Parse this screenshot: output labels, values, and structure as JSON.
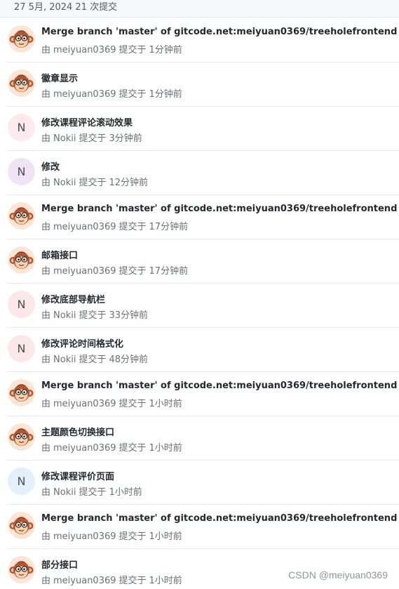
{
  "date_header": "27 5月, 2024 21 次提交",
  "commits": [
    {
      "title": "Merge branch 'master' of gitcode.net:meiyuan0369/treeholefrontend",
      "by": "由",
      "author": "meiyuan0369",
      "submitted": "提交于",
      "time": "1分钟前",
      "avatar": {
        "type": "monkey"
      }
    },
    {
      "title": "徽章显示",
      "by": "由",
      "author": "meiyuan0369",
      "submitted": "提交于",
      "time": "1分钟前",
      "avatar": {
        "type": "monkey"
      }
    },
    {
      "title": "修改课程评论滚动效果",
      "by": "由",
      "author": "Nokii",
      "submitted": "提交于",
      "time": "3分钟前",
      "avatar": {
        "type": "letter",
        "letter": "N",
        "color": "#fde9ee"
      }
    },
    {
      "title": "修改",
      "by": "由",
      "author": "Nokii",
      "submitted": "提交于",
      "time": "12分钟前",
      "avatar": {
        "type": "letter",
        "letter": "N",
        "color": "#f1e3f6"
      }
    },
    {
      "title": "Merge branch 'master' of gitcode.net:meiyuan0369/treeholefrontend",
      "by": "由",
      "author": "meiyuan0369",
      "submitted": "提交于",
      "time": "17分钟前",
      "avatar": {
        "type": "monkey"
      }
    },
    {
      "title": "邮箱接口",
      "by": "由",
      "author": "meiyuan0369",
      "submitted": "提交于",
      "time": "17分钟前",
      "avatar": {
        "type": "monkey"
      }
    },
    {
      "title": "修改底部导航栏",
      "by": "由",
      "author": "Nokii",
      "submitted": "提交于",
      "time": "33分钟前",
      "avatar": {
        "type": "letter",
        "letter": "N",
        "color": "#fce8e6"
      }
    },
    {
      "title": "修改评论时间格式化",
      "by": "由",
      "author": "Nokii",
      "submitted": "提交于",
      "time": "48分钟前",
      "avatar": {
        "type": "letter",
        "letter": "N",
        "color": "#fce8e6"
      }
    },
    {
      "title": "Merge branch 'master' of gitcode.net:meiyuan0369/treeholefrontend",
      "by": "由",
      "author": "meiyuan0369",
      "submitted": "提交于",
      "time": "1小时前",
      "avatar": {
        "type": "monkey"
      }
    },
    {
      "title": "主题颜色切换接口",
      "by": "由",
      "author": "meiyuan0369",
      "submitted": "提交于",
      "time": "1小时前",
      "avatar": {
        "type": "monkey"
      }
    },
    {
      "title": "修改课程评价页面",
      "by": "由",
      "author": "Nokii",
      "submitted": "提交于",
      "time": "1小时前",
      "avatar": {
        "type": "letter",
        "letter": "N",
        "color": "#e3f0fc"
      }
    },
    {
      "title": "Merge branch 'master' of gitcode.net:meiyuan0369/treeholefrontend",
      "by": "由",
      "author": "meiyuan0369",
      "submitted": "提交于",
      "time": "1小时前",
      "avatar": {
        "type": "monkey"
      }
    },
    {
      "title": "部分接口",
      "by": "由",
      "author": "meiyuan0369",
      "submitted": "提交于",
      "time": "1小时前",
      "avatar": {
        "type": "monkey"
      }
    }
  ],
  "watermark": "CSDN @meiyuan0369"
}
